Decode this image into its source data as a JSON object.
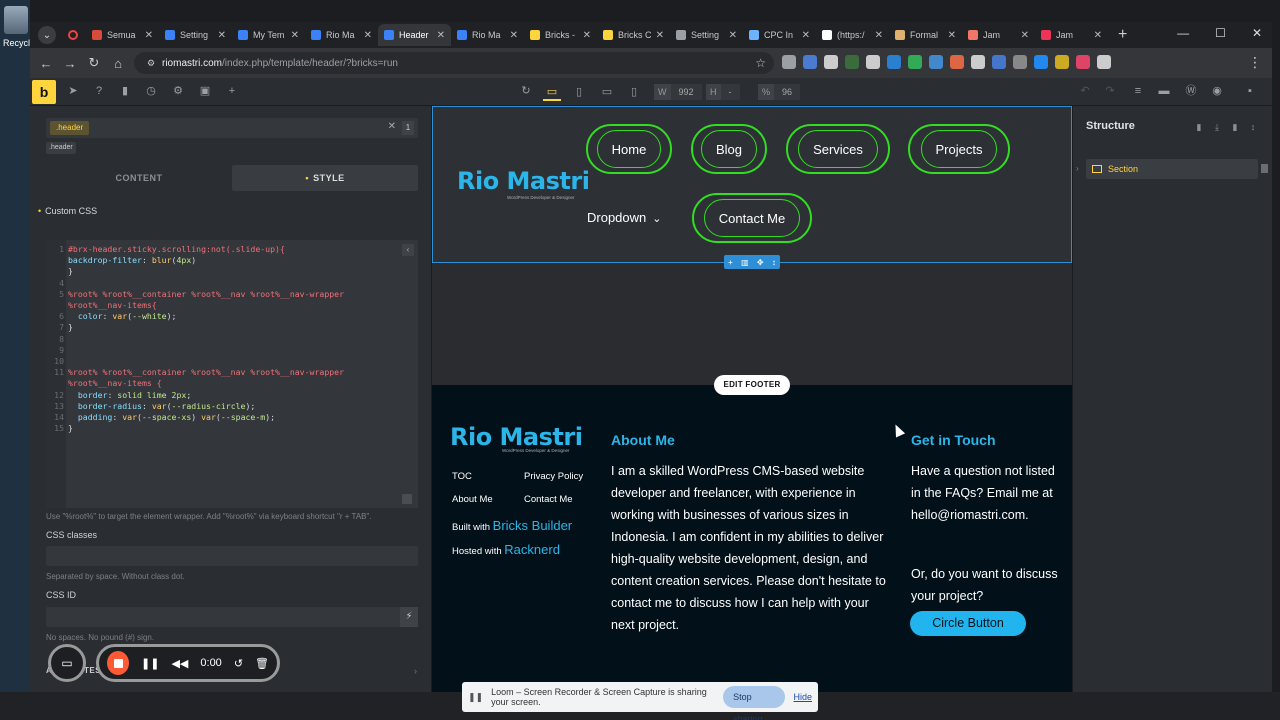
{
  "desktop": {
    "recycle_label": "Recycl"
  },
  "browser": {
    "tabs": [
      {
        "title": "Semua",
        "color": "#d84a3a",
        "active": false
      },
      {
        "title": "Setting",
        "color": "#3b82f6",
        "active": false
      },
      {
        "title": "My Tem",
        "color": "#3b82f6",
        "active": false
      },
      {
        "title": "Rio Ma",
        "color": "#3b82f6",
        "active": false
      },
      {
        "title": "Header",
        "color": "#3b82f6",
        "active": true
      },
      {
        "title": "Rio Ma",
        "color": "#3b82f6",
        "active": false
      },
      {
        "title": "Bricks -",
        "color": "#ffd53e",
        "active": false
      },
      {
        "title": "Bricks C",
        "color": "#ffd53e",
        "active": false
      },
      {
        "title": "Setting",
        "color": "#9aa0a6",
        "active": false
      },
      {
        "title": "CPC In",
        "color": "#6bb3ff",
        "active": false
      },
      {
        "title": "(https:/",
        "color": "#ffffff",
        "active": false
      },
      {
        "title": "Formal",
        "color": "#e0b070",
        "active": false
      },
      {
        "title": "Jam",
        "color": "#ee7766",
        "active": false
      },
      {
        "title": "Jam",
        "color": "#ee3355",
        "active": false
      }
    ],
    "url_host": "riomastri.com",
    "url_path": "/index.php/template/header/?bricks=run",
    "extension_colors": [
      "#9aa0a6",
      "#4a7bd0",
      "#cccccc",
      "#3a6b3a",
      "#cccccc",
      "#2a7fd0",
      "#33aa55",
      "#4488cc",
      "#dd6644",
      "#cccccc",
      "#4477cc",
      "#888888",
      "#2288ee",
      "#ccaa22",
      "#dd4466",
      "#cccccc"
    ]
  },
  "builder": {
    "logo": "b",
    "width_key": "W",
    "width_value": "992",
    "height_key": "H",
    "height_value": "-",
    "zoom_key": "%",
    "zoom_value": "96"
  },
  "left_panel": {
    "class_chip": ".header",
    "class_count": "1",
    "class_tag": ".header",
    "tab_content": "CONTENT",
    "tab_style": "STYLE",
    "custom_css_label": "Custom CSS",
    "css_hint": "Use \"%root%\" to target the element wrapper. Add \"%root%\" via keyboard shortcut \"r + TAB\".",
    "css_classes_label": "CSS classes",
    "css_classes_hint": "Separated by space. Without class dot.",
    "css_id_label": "CSS ID",
    "css_id_hint": "No spaces. No pound (#) sign.",
    "attributes_label": "ATTRIBUTES"
  },
  "code": {
    "lines": [
      {
        "n": "1",
        "parts": [
          [
            "sel",
            "#brx-header.sticky.scrolling:not(.slide-up){"
          ]
        ]
      },
      {
        "n": "",
        "parts": [
          [
            "prop",
            "backdrop-filter"
          ],
          [
            "punc",
            ": "
          ],
          [
            "fn",
            "blur"
          ],
          [
            "punc",
            "("
          ],
          [
            "val",
            "4px"
          ],
          [
            "punc",
            ")"
          ]
        ]
      },
      {
        "n": "",
        "parts": [
          [
            "punc",
            "}"
          ]
        ]
      },
      {
        "n": "4",
        "parts": []
      },
      {
        "n": "5",
        "parts": [
          [
            "sel",
            "%root% %root%__container %root%__nav %root%__nav-wrapper"
          ]
        ]
      },
      {
        "n": "",
        "parts": [
          [
            "sel",
            "%root%__nav-items{"
          ]
        ]
      },
      {
        "n": "6",
        "parts": [
          [
            "punc",
            "  "
          ],
          [
            "prop",
            "color"
          ],
          [
            "punc",
            ": "
          ],
          [
            "fn",
            "var"
          ],
          [
            "punc",
            "("
          ],
          [
            "val",
            "--white"
          ],
          [
            "punc",
            ");"
          ]
        ]
      },
      {
        "n": "7",
        "parts": [
          [
            "punc",
            "}"
          ]
        ]
      },
      {
        "n": "8",
        "parts": []
      },
      {
        "n": "9",
        "parts": []
      },
      {
        "n": "10",
        "parts": []
      },
      {
        "n": "11",
        "parts": [
          [
            "sel",
            "%root% %root%__container %root%__nav %root%__nav-wrapper"
          ]
        ]
      },
      {
        "n": "",
        "parts": [
          [
            "sel",
            "%root%__nav-items {"
          ]
        ]
      },
      {
        "n": "12",
        "parts": [
          [
            "punc",
            "  "
          ],
          [
            "prop",
            "border"
          ],
          [
            "punc",
            ": "
          ],
          [
            "val",
            "solid lime 2px"
          ],
          [
            "punc",
            ";"
          ]
        ]
      },
      {
        "n": "13",
        "parts": [
          [
            "punc",
            "  "
          ],
          [
            "prop",
            "border-radius"
          ],
          [
            "punc",
            ": "
          ],
          [
            "fn",
            "var"
          ],
          [
            "punc",
            "("
          ],
          [
            "val",
            "--radius-circle"
          ],
          [
            "punc",
            ");"
          ]
        ]
      },
      {
        "n": "14",
        "parts": [
          [
            "punc",
            "  "
          ],
          [
            "prop",
            "padding"
          ],
          [
            "punc",
            ": "
          ],
          [
            "fn",
            "var"
          ],
          [
            "punc",
            "("
          ],
          [
            "val",
            "--space-xs"
          ],
          [
            "punc",
            ") "
          ],
          [
            "fn",
            "var"
          ],
          [
            "punc",
            "("
          ],
          [
            "val",
            "--space-m"
          ],
          [
            "punc",
            ");"
          ]
        ]
      },
      {
        "n": "15",
        "parts": [
          [
            "punc",
            "}"
          ]
        ]
      }
    ]
  },
  "site": {
    "logo": "Rio Mastri",
    "logo_sub": "WordPress Developer & Designer",
    "nav": {
      "home": "Home",
      "blog": "Blog",
      "services": "Services",
      "projects": "Projects",
      "dropdown": "Dropdown",
      "contact": "Contact Me"
    },
    "edit_footer": "EDIT FOOTER",
    "footer": {
      "links": {
        "toc": "TOC",
        "privacy": "Privacy Policy",
        "about": "About Me",
        "contact": "Contact Me"
      },
      "built_prefix": "Built with",
      "built_brand": "Bricks Builder",
      "hosted_prefix": "Hosted with",
      "hosted_brand": "Racknerd",
      "about_title": "About Me",
      "about_text": "I am a skilled WordPress CMS-based website developer and freelancer, with experience in working with businesses of various sizes in Indonesia. I am confident in my abilities to deliver high-quality website development, design, and content creation services. Please don't hesitate to contact me to discuss how I can help with your next project.",
      "touch_title": "Get in Touch",
      "touch_text_1": "Have a question not listed in the FAQs? Email me at hello@riomastri.com.",
      "touch_text_2": "Or, do you want to discuss your project?",
      "circle_button": "Circle Button"
    }
  },
  "structure": {
    "title": "Structure",
    "item": "Section"
  },
  "loom": {
    "time": "0:00",
    "share_text": "Loom – Screen Recorder & Screen Capture is sharing your screen.",
    "stop_sharing": "Stop sharing",
    "hide": "Hide"
  }
}
